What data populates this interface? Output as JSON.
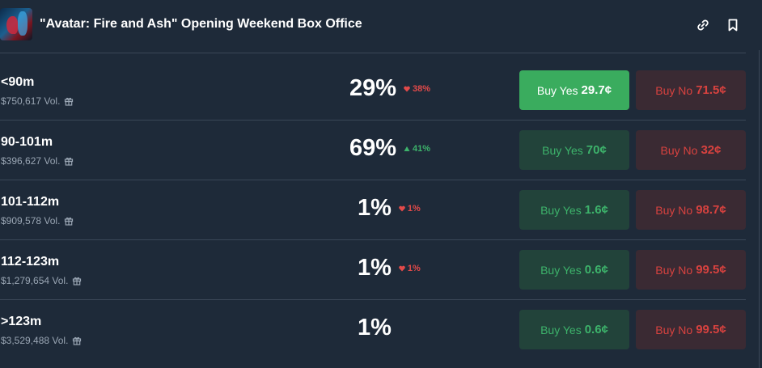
{
  "header": {
    "title": "\"Avatar: Fire and Ash\" Opening Weekend Box Office",
    "thumbnail_icon": "movie-poster",
    "link_icon": "link-icon",
    "bookmark_icon": "bookmark-icon"
  },
  "colors": {
    "background": "#1e2a39",
    "yes_green": "#3db36b",
    "no_red": "#d8423f",
    "yes_active": "#3aac5e"
  },
  "markets": [
    {
      "label": "<90m",
      "volume": "$750,617 Vol.",
      "percent": "29%",
      "change": "38%",
      "direction": "down",
      "yes_label": "Buy Yes",
      "yes_price": "29.7¢",
      "no_label": "Buy No",
      "no_price": "71.5¢",
      "yes_selected": true
    },
    {
      "label": "90-101m",
      "volume": "$396,627 Vol.",
      "percent": "69%",
      "change": "41%",
      "direction": "up",
      "yes_label": "Buy Yes",
      "yes_price": "70¢",
      "no_label": "Buy No",
      "no_price": "32¢",
      "yes_selected": false
    },
    {
      "label": "101-112m",
      "volume": "$909,578 Vol.",
      "percent": "1%",
      "change": "1%",
      "direction": "down",
      "yes_label": "Buy Yes",
      "yes_price": "1.6¢",
      "no_label": "Buy No",
      "no_price": "98.7¢",
      "yes_selected": false
    },
    {
      "label": "112-123m",
      "volume": "$1,279,654 Vol.",
      "percent": "1%",
      "change": "1%",
      "direction": "down",
      "yes_label": "Buy Yes",
      "yes_price": "0.6¢",
      "no_label": "Buy No",
      "no_price": "99.5¢",
      "yes_selected": false
    },
    {
      "label": ">123m",
      "volume": "$3,529,488 Vol.",
      "percent": "1%",
      "change": "",
      "direction": "none",
      "yes_label": "Buy Yes",
      "yes_price": "0.6¢",
      "no_label": "Buy No",
      "no_price": "99.5¢",
      "yes_selected": false
    }
  ]
}
